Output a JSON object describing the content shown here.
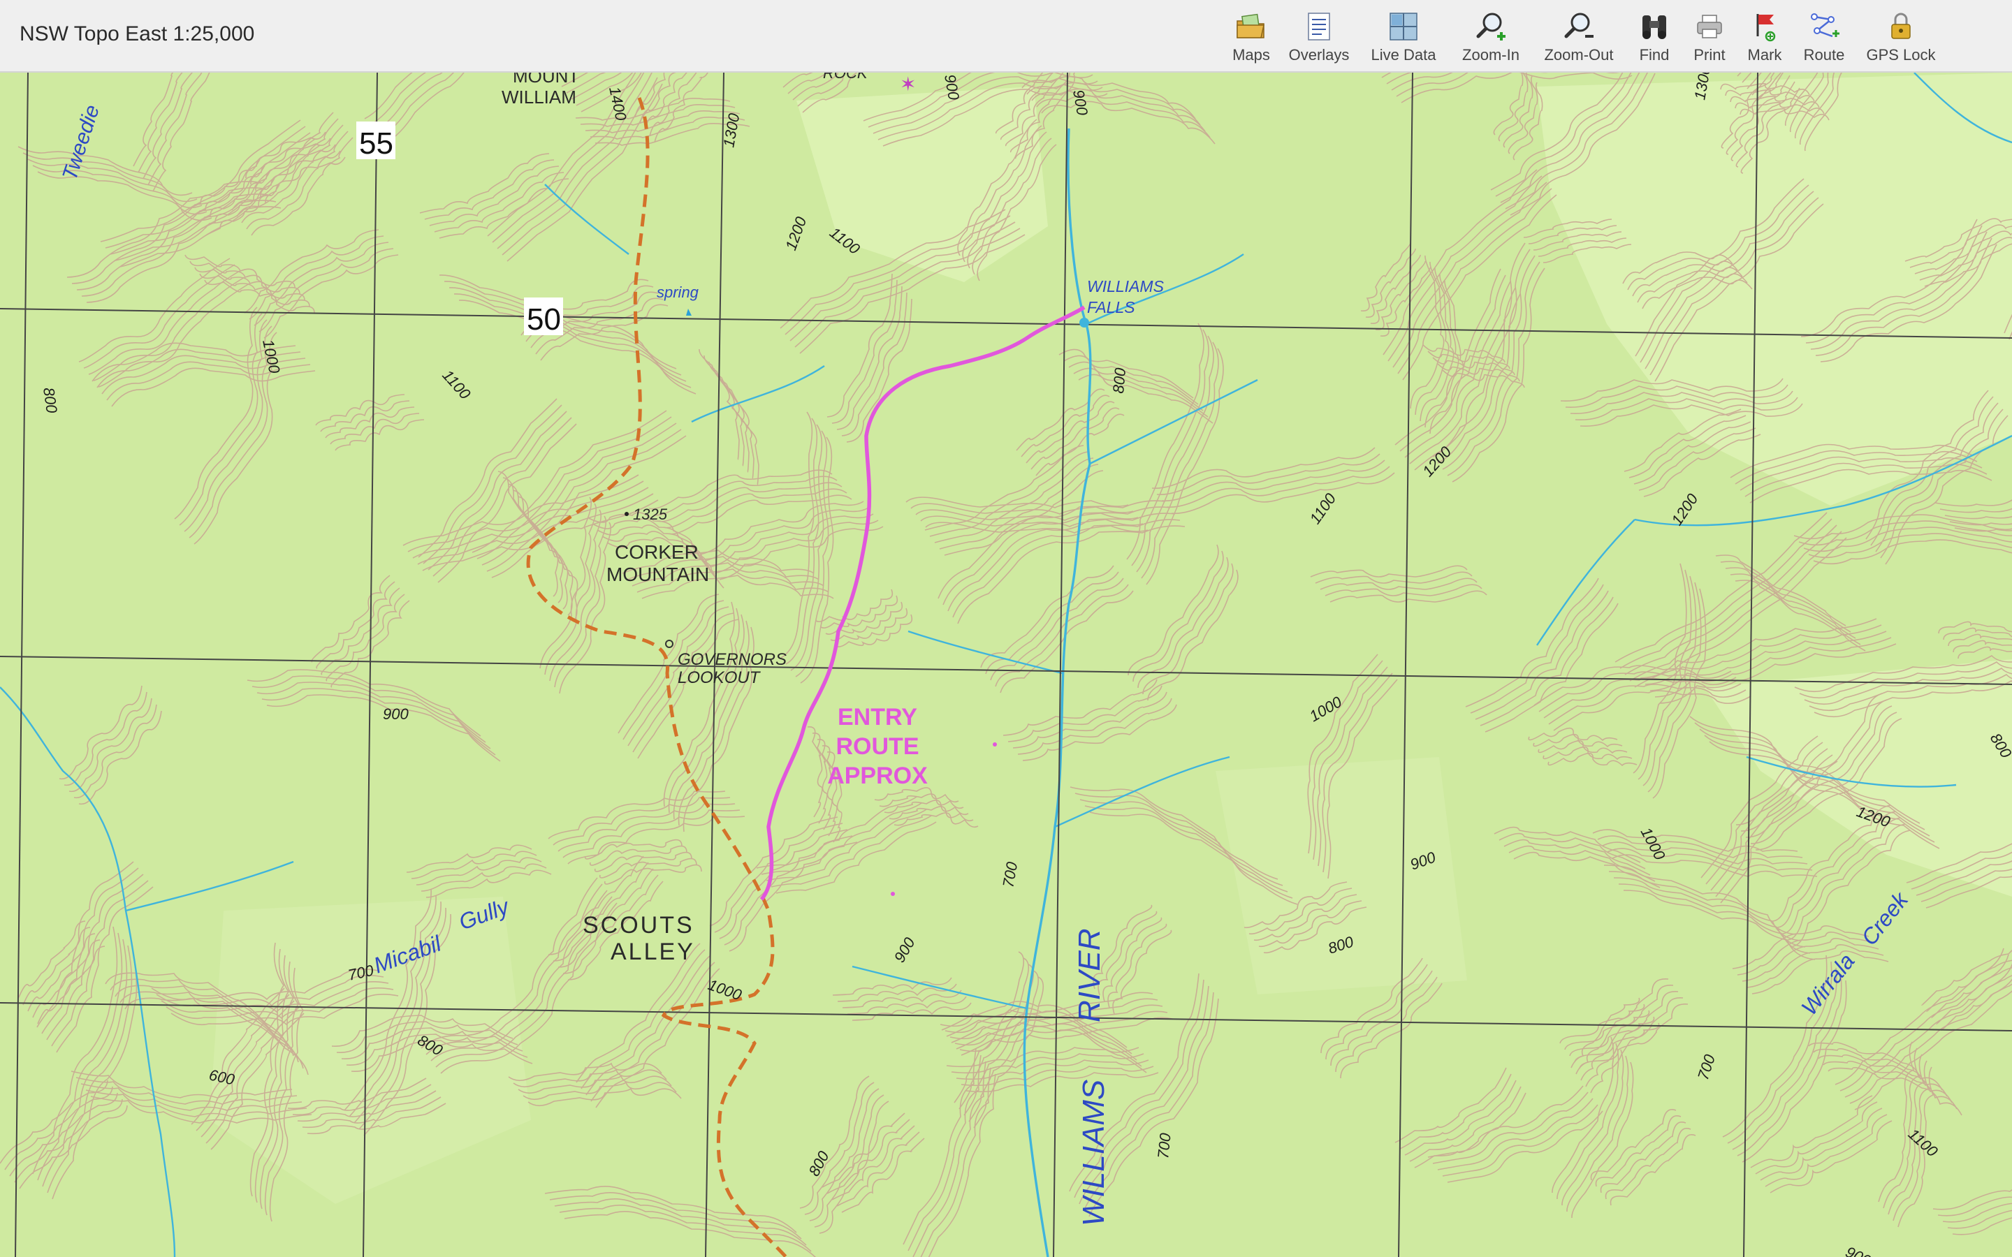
{
  "window": {
    "title": "NSW Topo East 1:25,000"
  },
  "toolbar": {
    "items": [
      {
        "id": "maps",
        "label": "Maps",
        "icon": "folder-maps-icon"
      },
      {
        "id": "overlays",
        "label": "Overlays",
        "icon": "overlays-list-icon"
      },
      {
        "id": "live",
        "label": "Live Data",
        "icon": "grid-table-icon"
      },
      {
        "id": "zoomin",
        "label": "Zoom-In",
        "icon": "magnifier-plus-icon"
      },
      {
        "id": "zoomout",
        "label": "Zoom-Out",
        "icon": "magnifier-minus-icon"
      },
      {
        "id": "find",
        "label": "Find",
        "icon": "binoculars-icon"
      },
      {
        "id": "print",
        "label": "Print",
        "icon": "printer-icon"
      },
      {
        "id": "mark",
        "label": "Mark",
        "icon": "flag-marker-icon"
      },
      {
        "id": "route",
        "label": "Route",
        "icon": "route-nodes-icon"
      },
      {
        "id": "gps",
        "label": "GPS Lock",
        "icon": "padlock-icon"
      }
    ]
  },
  "colors": {
    "terrain": "#cfeaa0",
    "terrain_light": "#e0f4b8",
    "contour": "#c9a894",
    "stream": "#3fb4dc",
    "road": "#d4722a",
    "route": "#e157dc",
    "grid": "#444444",
    "water_label": "#2d49c4"
  },
  "map": {
    "grid_numbers": [
      "55",
      "50"
    ],
    "place_names": {
      "mount_william_1": "MOUNT",
      "mount_william_2": "WILLIAM",
      "corker_1": "CORKER",
      "corker_2": "MOUNTAIN",
      "governors_1": "GOVERNORS",
      "governors_2": "LOOKOUT",
      "scouts_1": "SCOUTS",
      "scouts_2": "ALLEY",
      "rock": "ROCK",
      "falls_1": "WILLIAMS",
      "falls_2": "FALLS"
    },
    "spot_height": "1325",
    "spring": "spring",
    "water_names": {
      "tweedie": "Tweedie",
      "micabil": "Micabil",
      "gully": "Gully",
      "river": "RIVER",
      "williams": "WILLIAMS",
      "wirrala": "Wirrala",
      "creek": "Creek"
    },
    "route_label": [
      "ENTRY",
      "ROUTE",
      "APPROX"
    ],
    "contour_labels": [
      "1400",
      "1300",
      "900",
      "900",
      "1100",
      "1200",
      "1000",
      "1100",
      "800",
      "800",
      "1200",
      "1100",
      "1200",
      "900",
      "1000",
      "700",
      "900",
      "1000",
      "1200",
      "900",
      "800",
      "700",
      "800",
      "600",
      "700",
      "1000",
      "800",
      "700",
      "800",
      "1100",
      "900",
      "1300"
    ]
  }
}
